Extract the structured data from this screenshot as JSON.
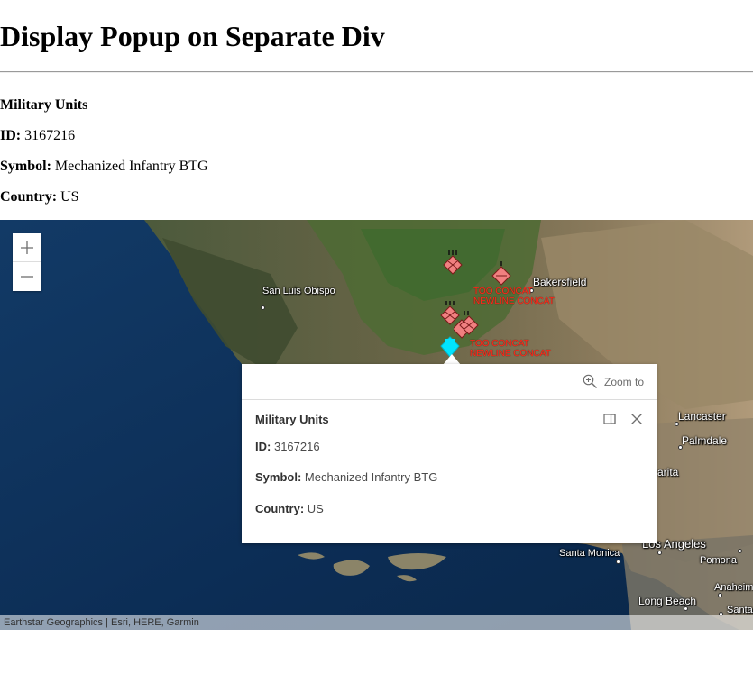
{
  "page": {
    "title": "Display Popup on Separate Div"
  },
  "info_panel": {
    "layer_title": "Military Units",
    "id_label": "ID:",
    "id_value": "3167216",
    "symbol_label": "Symbol:",
    "symbol_value": "Mechanized Infantry BTG",
    "country_label": "Country:",
    "country_value": "US"
  },
  "map": {
    "zoom_in_icon": "plus-icon",
    "zoom_out_icon": "minus-icon",
    "places": [
      "San Luis Obispo",
      "Bakersfield",
      "Lancaster",
      "Palmdale",
      "arita",
      "Santa Monica",
      "Los Angeles",
      "Pomona",
      "Long Beach",
      "Anaheim",
      "Santa"
    ],
    "unit_labels": [
      [
        "TOO CONCAT",
        "NEWLINE CONCAT"
      ],
      [
        "TOO CONCAT",
        "NEWLINE CONCAT"
      ]
    ],
    "attribution": "Earthstar Geographics | Esri, HERE, Garmin",
    "colors": {
      "ocean": "#0d3057",
      "unit_fill": "#f08080",
      "unit_label": "#ff2a1a",
      "selected": "#00e5ff"
    }
  },
  "popup": {
    "zoom_to_label": "Zoom to",
    "zoom_icon": "zoom-to-icon",
    "title": "Military Units",
    "id_label": "ID:",
    "id_value": "3167216",
    "symbol_label": "Symbol:",
    "symbol_value": "Mechanized Infantry BTG",
    "country_label": "Country:",
    "country_value": "US"
  }
}
